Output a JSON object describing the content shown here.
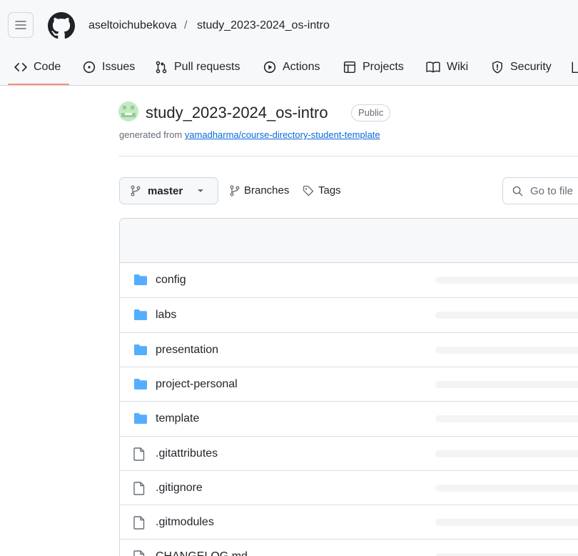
{
  "header": {
    "owner": "aseltoichubekova",
    "separator": "/",
    "repo": "study_2023-2024_os-intro"
  },
  "nav": {
    "tabs": [
      {
        "label": "Code",
        "icon": "code-icon"
      },
      {
        "label": "Issues",
        "icon": "issue-icon"
      },
      {
        "label": "Pull requests",
        "icon": "pull-request-icon"
      },
      {
        "label": "Actions",
        "icon": "play-icon"
      },
      {
        "label": "Projects",
        "icon": "table-icon"
      },
      {
        "label": "Wiki",
        "icon": "book-icon"
      },
      {
        "label": "Security",
        "icon": "shield-icon"
      }
    ],
    "active_tab": "Code"
  },
  "repo": {
    "title": "study_2023-2024_os-intro",
    "visibility": "Public",
    "generated_prefix": "generated from",
    "template_link": "yamadharma/course-directory-student-template"
  },
  "toolbar": {
    "branch": "master",
    "branches_label": "Branches",
    "tags_label": "Tags",
    "search_placeholder": "Go to file"
  },
  "files": [
    {
      "name": "config",
      "type": "folder"
    },
    {
      "name": "labs",
      "type": "folder"
    },
    {
      "name": "presentation",
      "type": "folder"
    },
    {
      "name": "project-personal",
      "type": "folder"
    },
    {
      "name": "template",
      "type": "folder"
    },
    {
      "name": ".gitattributes",
      "type": "file"
    },
    {
      "name": ".gitignore",
      "type": "file"
    },
    {
      "name": ".gitmodules",
      "type": "file"
    },
    {
      "name": "CHANGELOG.md",
      "type": "file"
    }
  ],
  "colors": {
    "folder": "#54aeff",
    "accent_underline": "#fd8c73",
    "link": "#0969da"
  }
}
